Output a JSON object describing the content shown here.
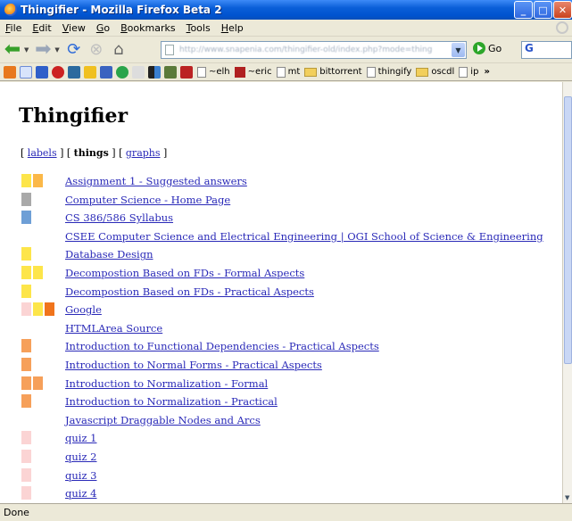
{
  "window": {
    "title": "Thingifier - Mozilla Firefox Beta 2"
  },
  "menu": [
    "File",
    "Edit",
    "View",
    "Go",
    "Bookmarks",
    "Tools",
    "Help"
  ],
  "toolbar": {
    "url": "http://www.snapenia.com/thingifier-old/index.php?mode=thing",
    "go_label": "Go",
    "search_value": "G"
  },
  "bookmarks": [
    "~elh",
    "~eric",
    "mt",
    "bittorrent",
    "thingify",
    "oscdl",
    "ip"
  ],
  "bookmarks_more": "»",
  "page": {
    "title": "Thingifier",
    "nav": {
      "open": "[ ",
      "labels": "labels",
      "sep1": " ] [ ",
      "things": "things",
      "sep2": " ] [ ",
      "graphs": "graphs",
      "close": " ]"
    }
  },
  "colors": {
    "yellow": "#fde54a",
    "orange": "#fbb848",
    "gray": "#a9a9a9",
    "blue": "#6e9fd6",
    "pink": "#fbd4d4",
    "darkorange": "#f0741c",
    "salmon": "#f6a05a",
    "link": "#2a2ab8"
  },
  "items": [
    {
      "label": "Assignment 1 - Suggested answers",
      "swatches": [
        "#fde54a",
        "#fbb848"
      ]
    },
    {
      "label": "Computer Science - Home Page",
      "swatches": [
        "#a9a9a9"
      ]
    },
    {
      "label": "CS 386/586 Syllabus",
      "swatches": [
        "#6e9fd6"
      ]
    },
    {
      "label": "CSEE Computer Science and Electrical Engineering | OGI School of Science & Engineering",
      "swatches": []
    },
    {
      "label": "Database Design",
      "swatches": [
        "#fde54a"
      ]
    },
    {
      "label": "Decompostion Based on FDs - Formal Aspects",
      "swatches": [
        "#fde54a",
        "#fde54a"
      ]
    },
    {
      "label": "Decompostion Based on FDs - Practical Aspects",
      "swatches": [
        "#fde54a"
      ]
    },
    {
      "label": "Google",
      "swatches": [
        "#fbd4d4",
        "#fde54a",
        "#f0741c"
      ]
    },
    {
      "label": "HTMLArea Source",
      "swatches": []
    },
    {
      "label": "Introduction to Functional Dependencies - Practical Aspects",
      "swatches": [
        "#f6a05a"
      ]
    },
    {
      "label": "Introduction to Normal Forms - Practical Aspects",
      "swatches": [
        "#f6a05a"
      ]
    },
    {
      "label": "Introduction to Normalization - Formal",
      "swatches": [
        "#f6a05a",
        "#f6a05a"
      ]
    },
    {
      "label": "Introduction to Normalization - Practical",
      "swatches": [
        "#f6a05a"
      ]
    },
    {
      "label": "Javascript Draggable Nodes and Arcs",
      "swatches": []
    },
    {
      "label": "quiz 1",
      "swatches": [
        "#fbd4d4"
      ]
    },
    {
      "label": "quiz 2",
      "swatches": [
        "#fbd4d4"
      ]
    },
    {
      "label": "quiz 3",
      "swatches": [
        "#fbd4d4"
      ]
    },
    {
      "label": "quiz 4",
      "swatches": [
        "#fbd4d4"
      ]
    }
  ],
  "status": "Done"
}
